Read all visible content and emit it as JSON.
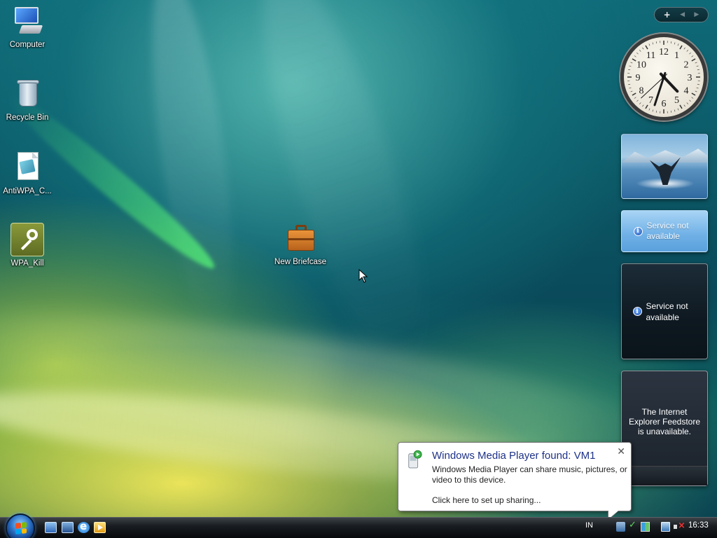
{
  "desktop": {
    "icons": [
      {
        "label": "Computer"
      },
      {
        "label": "Recycle Bin"
      },
      {
        "label": "AntiWPA_C..."
      },
      {
        "label": "WPA_Kill"
      },
      {
        "label": "New Briefcase"
      }
    ]
  },
  "sidebar": {
    "controls": {
      "add": "+",
      "prev": "◀",
      "next": "▶"
    },
    "clock": {
      "numerals": [
        "12",
        "1",
        "2",
        "3",
        "4",
        "5",
        "6",
        "7",
        "8",
        "9",
        "10",
        "11"
      ],
      "hour": 16,
      "minute": 33
    },
    "weather": {
      "message": "Service not available"
    },
    "dark_gadget": {
      "message": "Service not available"
    },
    "feed": {
      "message": "The Internet Explorer Feedstore is unavailable."
    }
  },
  "notification": {
    "title": "Windows Media Player found: VM1",
    "body": "Windows Media Player can share music, pictures, or video to this device.",
    "link": "Click here to set up sharing...",
    "close": "✕"
  },
  "taskbar": {
    "quick_launch": [
      "show-desktop-icon",
      "switch-windows-icon",
      "internet-explorer-icon",
      "media-player-icon"
    ],
    "language": "IN",
    "time": "16:33"
  }
}
